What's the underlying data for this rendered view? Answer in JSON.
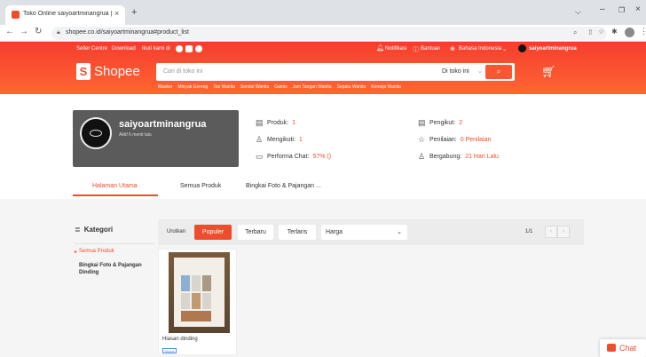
{
  "browser": {
    "tab_title": "Toko Online saiyoartminangrua | Sh",
    "url": "shopee.co.id/saiyoartminangrua#product_list",
    "new_tab": "+",
    "close_tab": "×"
  },
  "topnav": {
    "seller_centre": "Seller Centre",
    "download": "Download",
    "follow": "Ikuti kami di",
    "notifications": "Notifikasi",
    "help": "Bantuan",
    "language": "Bahasa Indonesia",
    "username": "saiyoartminangrua"
  },
  "header": {
    "logo": "Shopee",
    "search_placeholder": "Cari di toko ini",
    "search_scope": "Di toko ini",
    "keywords": [
      "Masker",
      "Minyak Goreng",
      "Tas Wanita",
      "Sendal Wanita",
      "Gamis",
      "Jam Tangan Wanita",
      "Sepatu Wanita",
      "Kemeja Wanita"
    ]
  },
  "shop": {
    "name": "saiyoartminangrua",
    "status": "Aktif 6 menit lalu",
    "stats": {
      "produk_label": "Produk:",
      "produk_value": "1",
      "mengikuti_label": "Mengikuti:",
      "mengikuti_value": "1",
      "performa_label": "Performa Chat:",
      "performa_value": "57% ()",
      "pengikut_label": "Pengikut:",
      "pengikut_value": "2",
      "penilaian_label": "Penilaian:",
      "penilaian_value": "0 Penilaian",
      "bergabung_label": "Bergabung:",
      "bergabung_value": "21 Hari Lalu"
    }
  },
  "tabs": [
    "Halaman Utama",
    "Semua Produk",
    "Bingkai Foto & Pajangan ..."
  ],
  "category": {
    "title": "Kategori",
    "items": [
      "Semua Produk",
      "Bingkai Foto & Pajangan Dinding"
    ]
  },
  "sort": {
    "label": "Urutkan",
    "options": [
      "Populer",
      "Terbaru",
      "Terlaris"
    ],
    "price": "Harga",
    "page": "1/1"
  },
  "product": {
    "name": "Hiasan dinding",
    "badge": "Shope"
  },
  "chat": {
    "label": "Chat"
  },
  "colors": {
    "brand": "#ee4d2d"
  }
}
